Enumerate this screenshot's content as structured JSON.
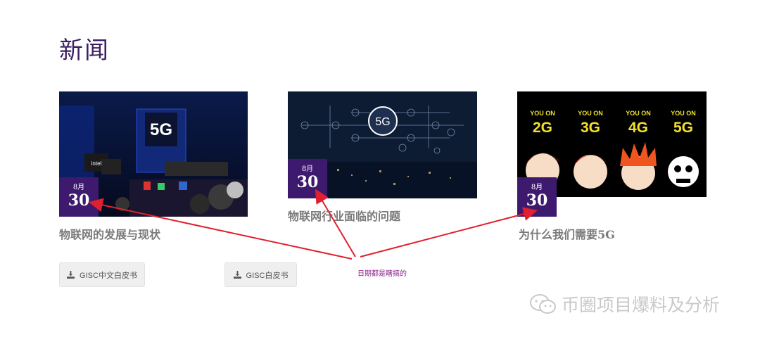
{
  "section": {
    "title": "新闻"
  },
  "cards": [
    {
      "month": "8月",
      "day": "30",
      "title": "物联网的发展与现状"
    },
    {
      "month": "8月",
      "day": "30",
      "title": "物联网行业面临的问题"
    },
    {
      "month": "8月",
      "day": "30",
      "title": "为什么我们需要5G"
    }
  ],
  "images": {
    "expo": {
      "sign": "5G",
      "brand": "intel"
    },
    "network": {
      "label": "5G"
    },
    "cartoon": {
      "labels": [
        "YOU ON",
        "YOU ON",
        "YOU ON",
        "YOU ON"
      ],
      "generations": [
        "2G",
        "3G",
        "4G",
        "5G"
      ]
    }
  },
  "buttons": [
    {
      "label": "GISC中文白皮书",
      "icon": "download-icon"
    },
    {
      "label": "GISC白皮书",
      "icon": "download-icon"
    }
  ],
  "annotation": {
    "text": "日期都是瞎搞的",
    "color": "#8a1d8a"
  },
  "watermark": {
    "text": "币圈项目爆料及分析",
    "icon": "wechat-icon"
  },
  "colors": {
    "title": "#3b1f63",
    "badge": "#3d1a6e",
    "arrow": "#e0202e"
  }
}
